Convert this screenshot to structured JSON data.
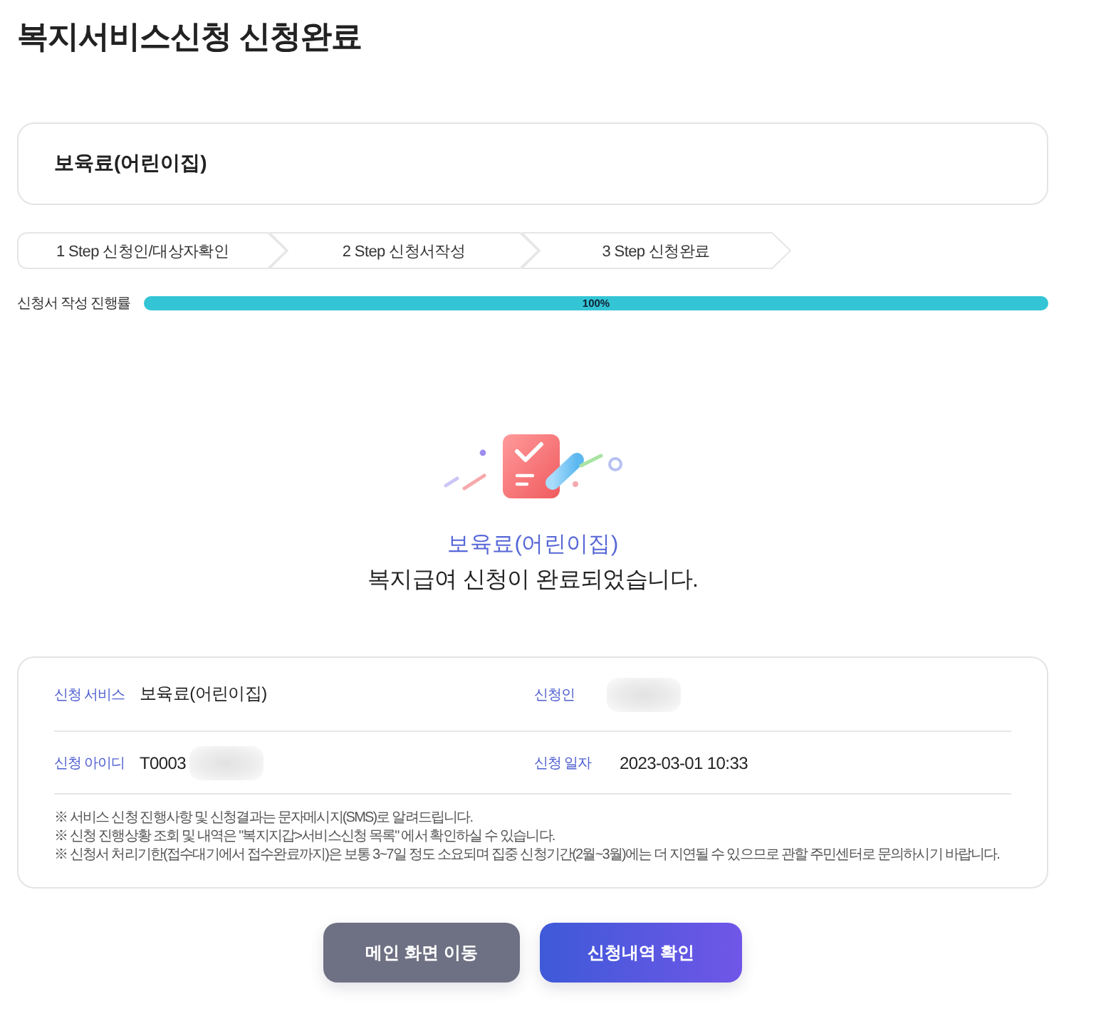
{
  "page": {
    "title": "복지서비스신청 신청완료"
  },
  "service_card": {
    "name": "보육료(어린이집)"
  },
  "steps": [
    {
      "label": "1 Step 신청인/대상자확인"
    },
    {
      "label": "2 Step 신청서작성"
    },
    {
      "label": "3 Step 신청완료"
    }
  ],
  "progress": {
    "label": "신청서 작성 진행률",
    "level": 1,
    "reading": "100%"
  },
  "completion": {
    "service": "보육료(어린이집)",
    "message": "복지급여 신청이 완료되었습니다."
  },
  "details": {
    "rows": [
      [
        {
          "label": "신청 서비스",
          "value": "보육료(어린이집)"
        },
        {
          "label": "신청인",
          "redacted": true
        }
      ],
      [
        {
          "label": "신청 아이디",
          "value": "T0003",
          "redacted": true
        },
        {
          "label": "신청 일자",
          "value": "2023-03-01 10:33"
        }
      ]
    ],
    "notes": [
      "※ 서비스 신청 진행사항 및 신청결과는 문자메시지(SMS)로 알려드립니다.",
      "※ 신청 진행상황 조회 및 내역은 \"복지지갑>서비스신청 목록\" 에서 확인하실 수 있습니다.",
      "※ 신청서 처리기한(접수대기에서 접수완료까지)은 보통 3~7일 정도 소요되며 집중 신청기간(2월~3월)에는 더 지연될 수 있으므로 관할 주민센터로 문의하시기 바랍니다."
    ]
  },
  "buttons": [
    {
      "label": "메인 화면 이동",
      "kind": "secondary"
    },
    {
      "label": "신청내역 확인",
      "kind": "primary"
    }
  ]
}
